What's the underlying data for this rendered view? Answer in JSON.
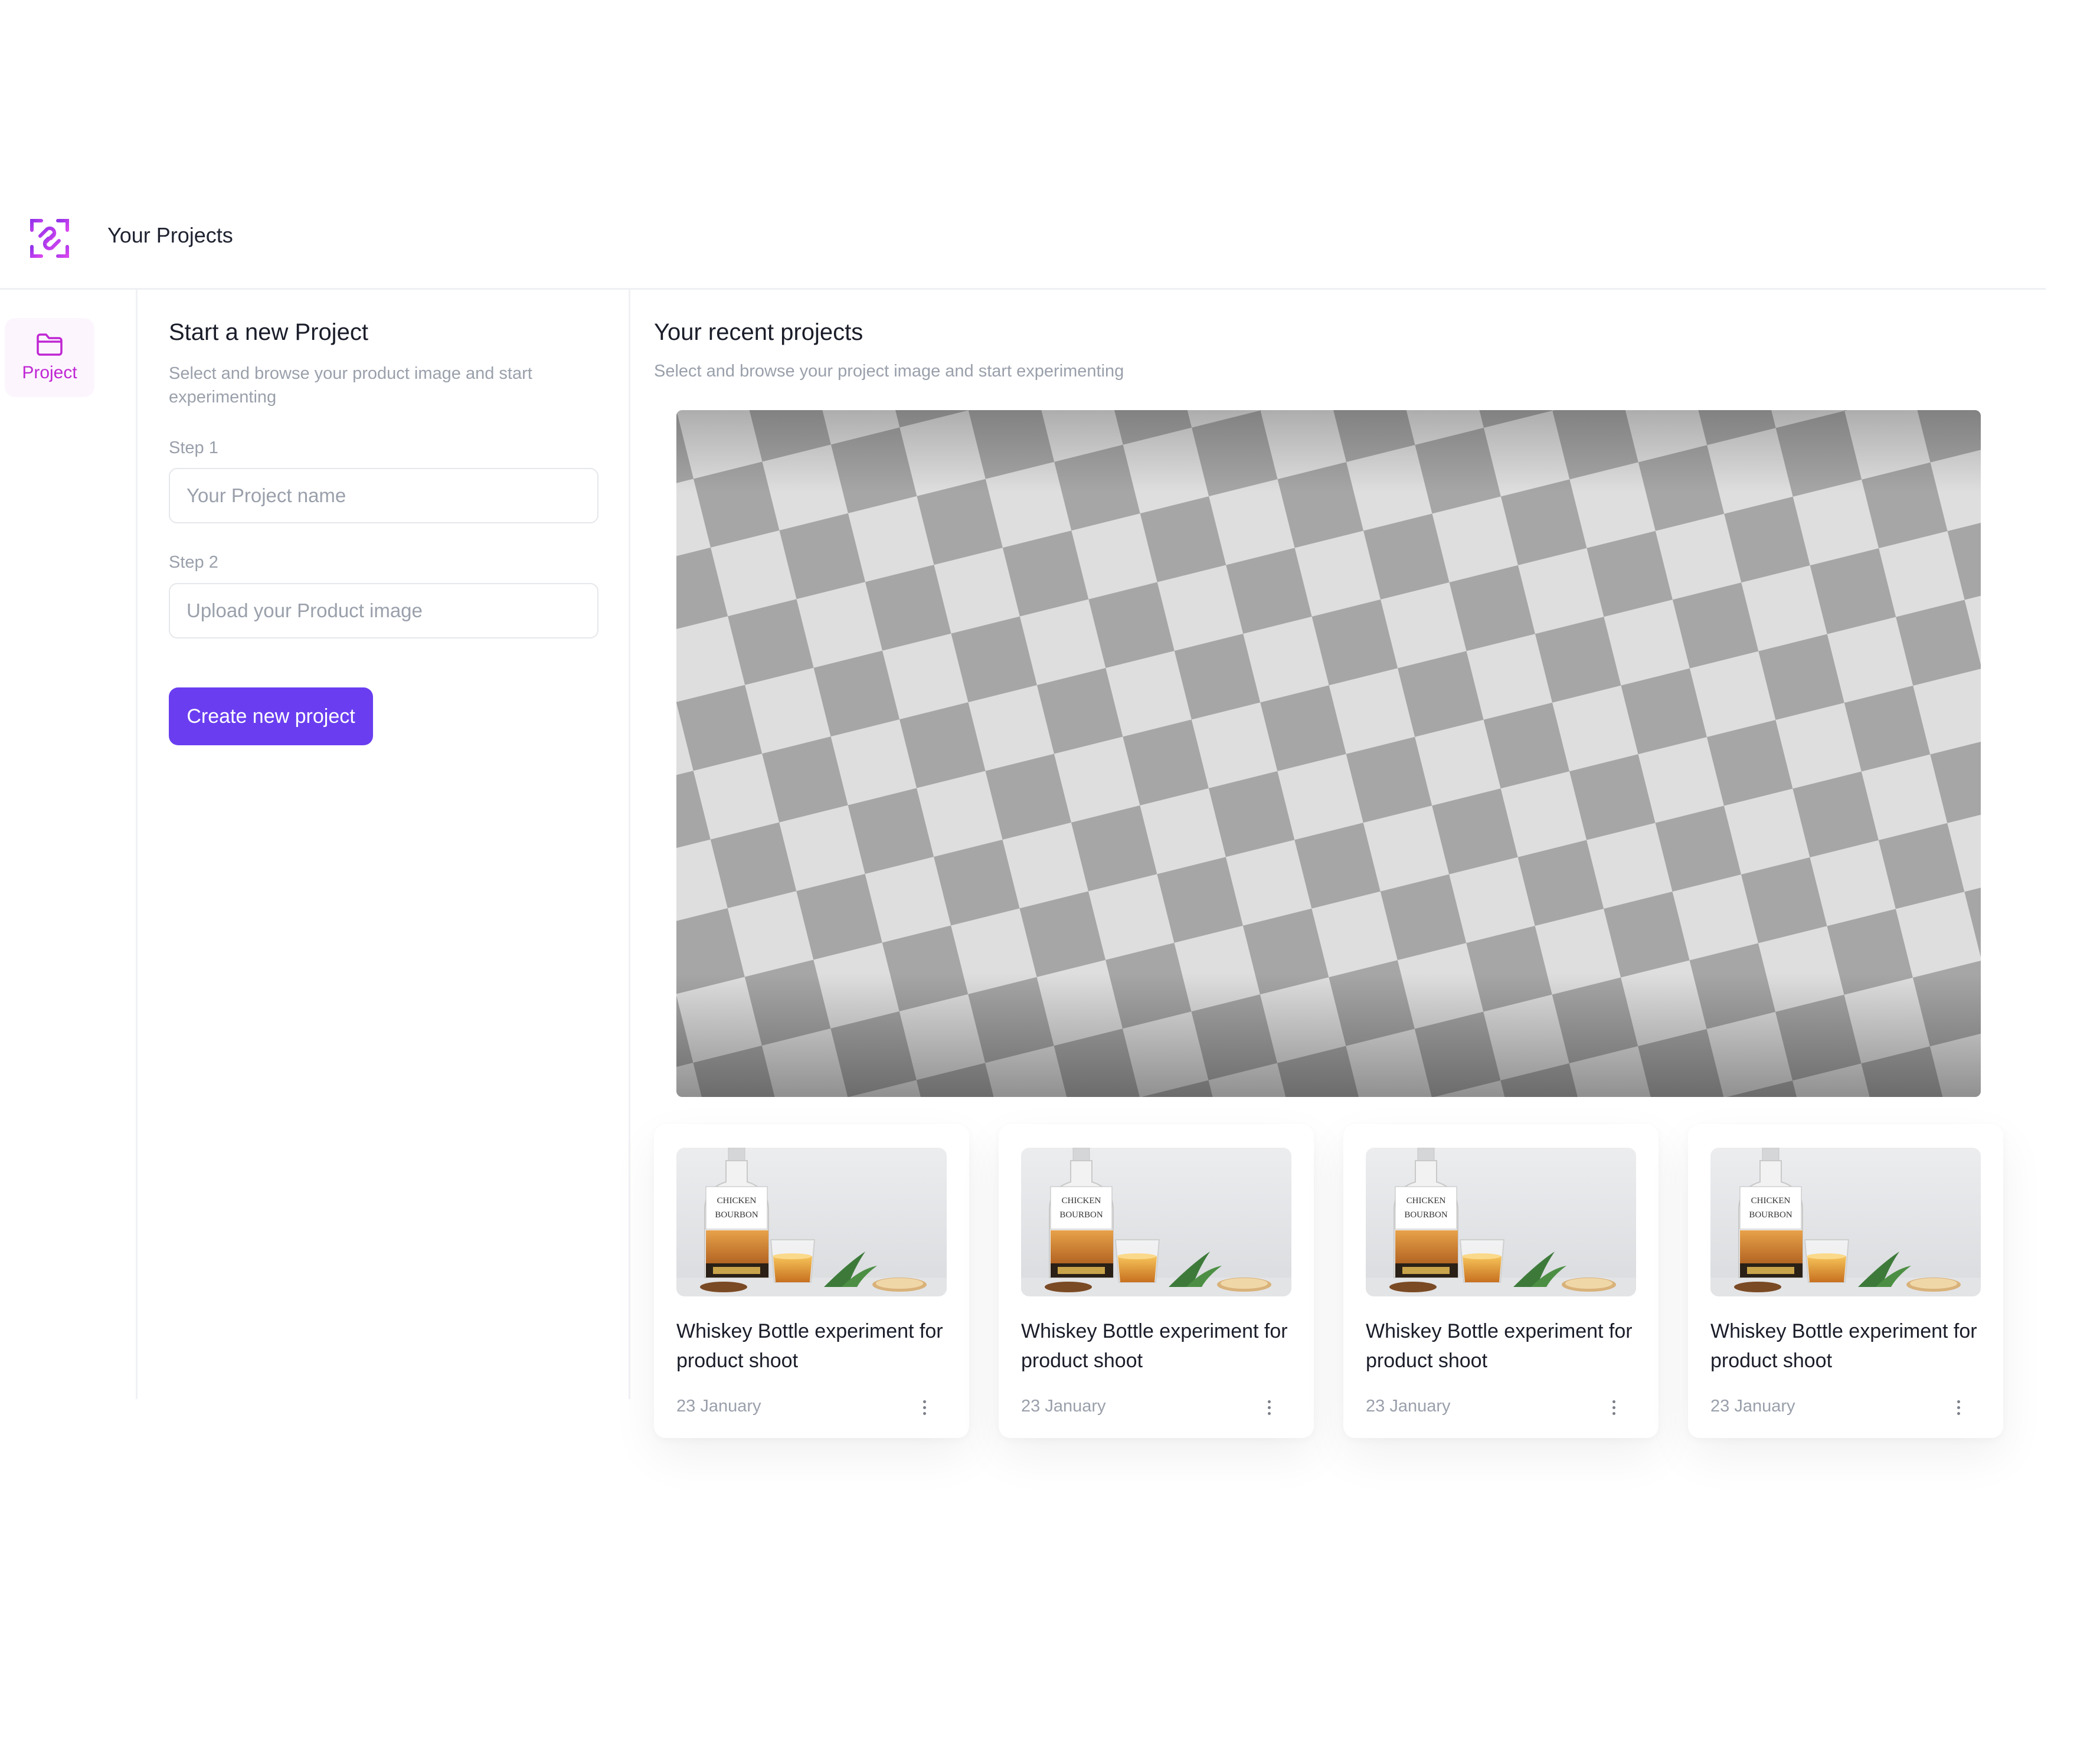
{
  "header": {
    "title": "Your Projects",
    "logo_icon": "link-scan-icon",
    "brand_colors": [
      "#9333ea",
      "#d946ef"
    ]
  },
  "sidebar": {
    "items": [
      {
        "label": "Project",
        "icon": "folder-icon",
        "active": true,
        "color": "#c026d3"
      }
    ]
  },
  "new_project": {
    "title": "Start a new Project",
    "subtitle": "Select and browse your product image and start experimenting",
    "step1_label": "Step 1",
    "name_placeholder": "Your Project name",
    "name_value": "",
    "step2_label": "Step 2",
    "upload_placeholder": "Upload your Product image",
    "create_button": "Create new project",
    "button_color": "#6a3ef0"
  },
  "recent": {
    "title": "Your recent projects",
    "subtitle": "Select and browse your project image and start experimenting",
    "preview_icon": "transparent-checkerboard-preview",
    "projects": [
      {
        "title": "Whiskey Bottle experiment for product shoot",
        "date": "23 January",
        "menu_icon": "more-vertical-icon"
      },
      {
        "title": "Whiskey Bottle experiment for product shoot",
        "date": "23 January",
        "menu_icon": "more-vertical-icon"
      },
      {
        "title": "Whiskey Bottle experiment for product shoot",
        "date": "23 January",
        "menu_icon": "more-vertical-icon"
      },
      {
        "title": "Whiskey Bottle experiment for product shoot",
        "date": "23 January",
        "menu_icon": "more-vertical-icon"
      }
    ]
  }
}
